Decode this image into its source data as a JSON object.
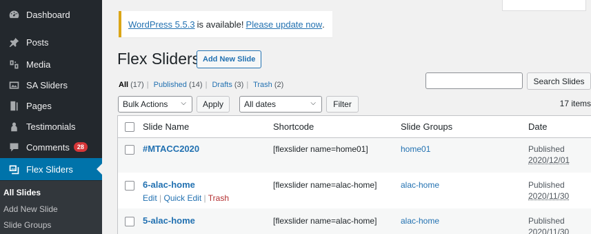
{
  "sidebar": {
    "items": [
      {
        "label": "Dashboard",
        "icon": "dashboard-icon"
      },
      {
        "label": "Posts",
        "icon": "pin-icon"
      },
      {
        "label": "Media",
        "icon": "media-icon"
      },
      {
        "label": "SA Sliders",
        "icon": "slides-icon"
      },
      {
        "label": "Pages",
        "icon": "page-icon"
      },
      {
        "label": "Testimonials",
        "icon": "people-icon"
      },
      {
        "label": "Comments",
        "icon": "comment-icon",
        "badge": "28"
      },
      {
        "label": "Flex Sliders",
        "icon": "gallery-icon"
      }
    ],
    "submenu": [
      "All Slides",
      "Add New Slide",
      "Slide Groups"
    ]
  },
  "notice": {
    "version_link": "WordPress 5.5.3",
    "middle": "is available!",
    "update_link": "Please update now",
    "end": "."
  },
  "page": {
    "title": "Flex Sliders",
    "add_new": "Add New Slide"
  },
  "filters": {
    "all": "All",
    "all_count": "(17)",
    "published": "Published",
    "published_count": "(14)",
    "drafts": "Drafts",
    "drafts_count": "(3)",
    "trash": "Trash",
    "trash_count": "(2)",
    "sep": "|"
  },
  "search": {
    "button": "Search Slides",
    "value": ""
  },
  "toolbar": {
    "bulk_actions": "Bulk Actions",
    "apply": "Apply",
    "dates": "All dates",
    "filter": "Filter",
    "items_count": "17 items"
  },
  "table": {
    "headers": {
      "name": "Slide Name",
      "shortcode": "Shortcode",
      "groups": "Slide Groups",
      "date": "Date"
    },
    "rows": [
      {
        "name": "#MTACC2020",
        "shortcode": "[flexslider name=home01]",
        "group": "home01",
        "status": "Published",
        "date": "2020/12/01"
      },
      {
        "name": "6-alac-home",
        "shortcode": "[flexslider name=alac-home]",
        "group": "alac-home",
        "status": "Published",
        "date": "2020/11/30"
      },
      {
        "name": "5-alac-home",
        "shortcode": "[flexslider name=alac-home]",
        "group": "alac-home",
        "status": "Published",
        "date": "2020/11/30"
      }
    ],
    "row_actions": {
      "edit": "Edit",
      "quick_edit": "Quick Edit",
      "trash": "Trash",
      "sep": "|"
    }
  },
  "colors": {
    "sidebar_bg": "#23282d",
    "active": "#0073aa",
    "link": "#2271b1",
    "badge": "#d63638",
    "notice_border": "#dba617",
    "trash": "#b32d2e"
  }
}
